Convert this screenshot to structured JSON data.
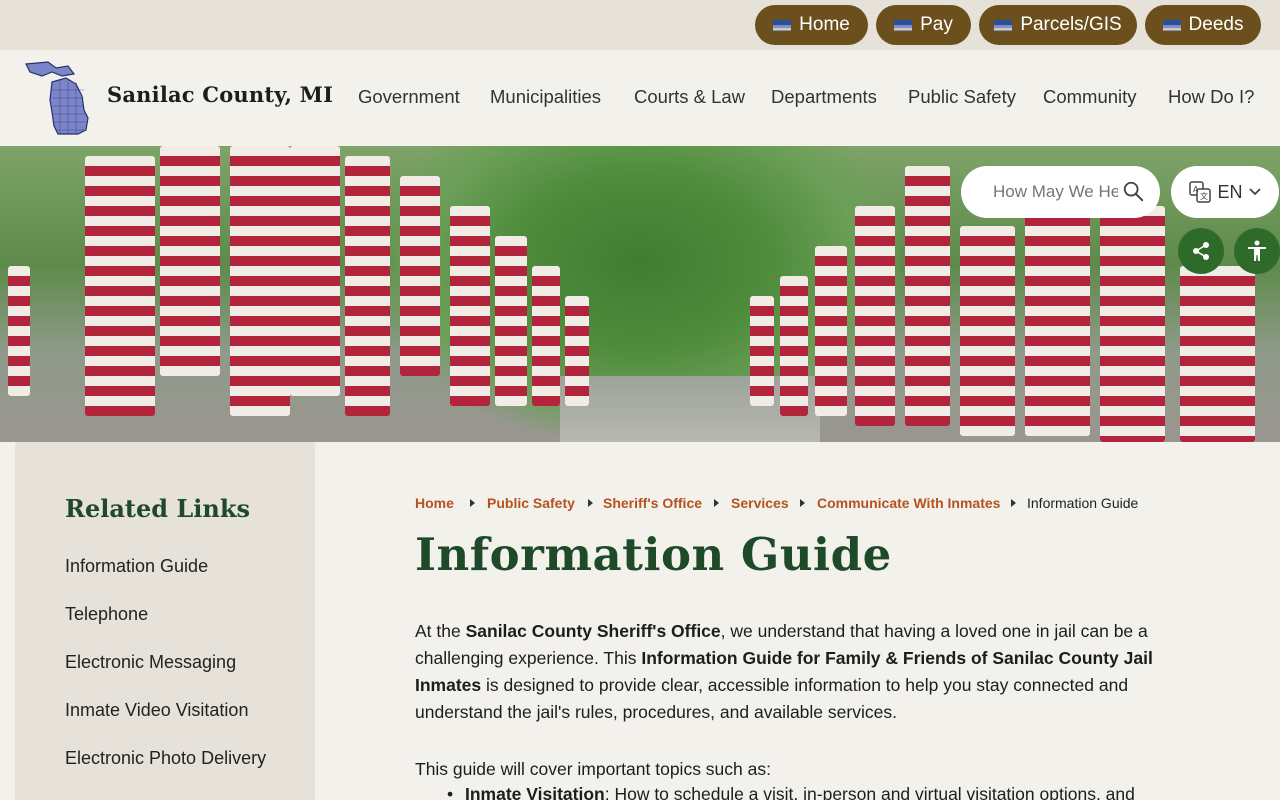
{
  "utility_links": [
    "Home",
    "Pay",
    "Parcels/GIS",
    "Deeds"
  ],
  "site_name": "Sanilac County, MI",
  "nav": [
    "Government",
    "Municipalities",
    "Courts & Law",
    "Departments",
    "Public Safety",
    "Community",
    "How Do I?"
  ],
  "search": {
    "placeholder": "How May We Help You?"
  },
  "language": {
    "current": "EN"
  },
  "colors": {
    "brown": "#6b4f1d",
    "green": "#1f4a2a",
    "accent_orange": "#b5531e"
  },
  "sidebar": {
    "title": "Related Links",
    "links": [
      "Information Guide",
      "Telephone",
      "Electronic Messaging",
      "Inmate Video Visitation",
      "Electronic Photo Delivery"
    ]
  },
  "breadcrumb": [
    "Home",
    "Public Safety",
    "Sheriff's Office",
    "Services",
    "Communicate With Inmates",
    "Information Guide"
  ],
  "page_title": "Information Guide",
  "intro": {
    "t1": "At the ",
    "b1": "Sanilac County Sheriff's Office",
    "t2": ", we understand that having a loved one in jail can be a challenging experience. This ",
    "b2": "Information Guide for Family & Friends of Sanilac County Jail Inmates",
    "t3": " is designed to provide clear, accessible information to help you stay connected and understand the jail's rules, procedures, and available services."
  },
  "topics_intro": "This guide will cover important topics such as:",
  "topics": [
    {
      "label": "Inmate Visitation",
      "text": ": How to schedule a visit, in-person and virtual visitation options, and"
    }
  ]
}
